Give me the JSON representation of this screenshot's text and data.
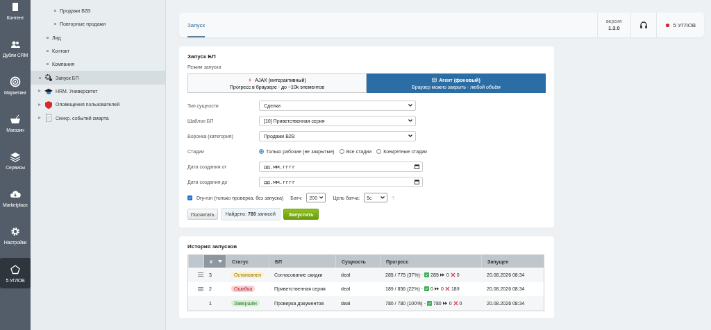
{
  "rail": [
    {
      "kind": "content",
      "label": "Контент",
      "selected": false
    },
    {
      "kind": "people",
      "label": "Дубли CRM",
      "selected": false
    },
    {
      "kind": "target",
      "label": "Маркетинг",
      "selected": false
    },
    {
      "kind": "basket",
      "label": "Магазин",
      "selected": false
    },
    {
      "kind": "layers",
      "label": "Сервисы",
      "selected": false
    },
    {
      "kind": "cloud",
      "label": "Marketplace",
      "selected": false
    },
    {
      "kind": "gear",
      "label": "Настройки",
      "selected": false
    },
    {
      "kind": "pentagon",
      "label": "5 УГЛОВ",
      "selected": true
    }
  ],
  "tree": [
    {
      "children": [
        {
          "children": [
            {
              "label": "Продажи B2B",
              "selected": false
            },
            {
              "label": "Повторные продажи",
              "selected": false
            }
          ]
        },
        {
          "label": "Лид",
          "selected": false
        },
        {
          "label": "Контакт",
          "selected": false
        },
        {
          "label": "Компания",
          "selected": false
        }
      ]
    },
    {
      "kind": "gears",
      "label": "Запуск БП",
      "selected": true,
      "expandable": false
    },
    {
      "kind": "cap",
      "label": "HRM. Университет",
      "selected": false,
      "expandable": true
    },
    {
      "kind": "shield",
      "label": "Оповещения пользователей",
      "selected": false,
      "expandable": true
    },
    {
      "kind": "doc",
      "label": "Синхр. событий смарта",
      "selected": false,
      "expandable": true
    }
  ],
  "header": {
    "tabs": [
      {
        "label": "Запуск",
        "selected": true
      }
    ],
    "version_label": "версия",
    "version": "1.3.0",
    "brand": "5 УГЛОВ"
  },
  "launch": {
    "title": "Запуск БП",
    "mode_label": "Режим запуска",
    "modes": [
      {
        "kind": "ajax",
        "title": "AJAX (интерактивный)",
        "hint": "Прогресс в браузере · до ~10k элементов",
        "selected": false
      },
      {
        "kind": "agent",
        "title": "Агент (фоновый)",
        "hint": "Браузер можно закрыть · любой объём",
        "selected": true
      }
    ],
    "fields": [
      {
        "kind": "select",
        "label": "Тип сущности",
        "value": "Сделки"
      },
      {
        "kind": "select",
        "label": "Шаблон БП",
        "value": "[10] Приветственная серия"
      },
      {
        "kind": "select",
        "label": "Воронка (категория)",
        "value": "Продажи B2B"
      },
      {
        "kind": "radio",
        "label": "Стадии",
        "options": [
          {
            "label": "Только рабочие (не закрытые)",
            "selected": true
          },
          {
            "label": "Все стадии",
            "selected": false
          },
          {
            "label": "Конкретные стадии",
            "selected": false
          }
        ]
      },
      {
        "kind": "date",
        "label": "Дата создания от",
        "placeholder": "дд.мм.гггг"
      },
      {
        "kind": "date",
        "label": "Дата создания до",
        "placeholder": "дд.мм.гггг"
      }
    ],
    "dry_run": {
      "label": "Dry-run (только проверка, без запуска)",
      "checked": true
    },
    "batch": {
      "label": "Батч:",
      "value": "200"
    },
    "batch_target": {
      "label": "Цель батча:",
      "value": "5с"
    },
    "help": "?",
    "count_button": "Посчитать",
    "found": "Найдено: **780** записей",
    "run_button": "Запустить"
  },
  "history": {
    "title": "История запусков",
    "columns": [
      "#",
      "Статус",
      "БП",
      "Сущность",
      "Прогресс",
      "Запущен"
    ],
    "rows": [
      {
        "handle": true,
        "id": "3",
        "status": {
          "kind": "stopped",
          "label": "Остановлен"
        },
        "bp": "Согласование скидки",
        "entity": "deal",
        "progress": "285 / 775 (37%) ·",
        "ok": "285",
        "skipped": "0",
        "errors": "0",
        "started": "20.08.2026 08:34"
      },
      {
        "handle": true,
        "id": "2",
        "status": {
          "kind": "error",
          "label": "Ошибка"
        },
        "bp": "Приветственная серия",
        "entity": "deal",
        "progress": "189 / 856 (22%) ·",
        "ok": "0",
        "skipped": "0",
        "errors": "189",
        "started": "20.08.2026 08:34"
      },
      {
        "handle": false,
        "id": "1",
        "status": {
          "kind": "done",
          "label": "Завершён"
        },
        "bp": "Проверка документов",
        "entity": "deal",
        "progress": "780 / 780 (100%) ·",
        "ok": "780",
        "skipped": "0",
        "errors": "0",
        "started": "20.08.2026 08:34"
      }
    ]
  }
}
